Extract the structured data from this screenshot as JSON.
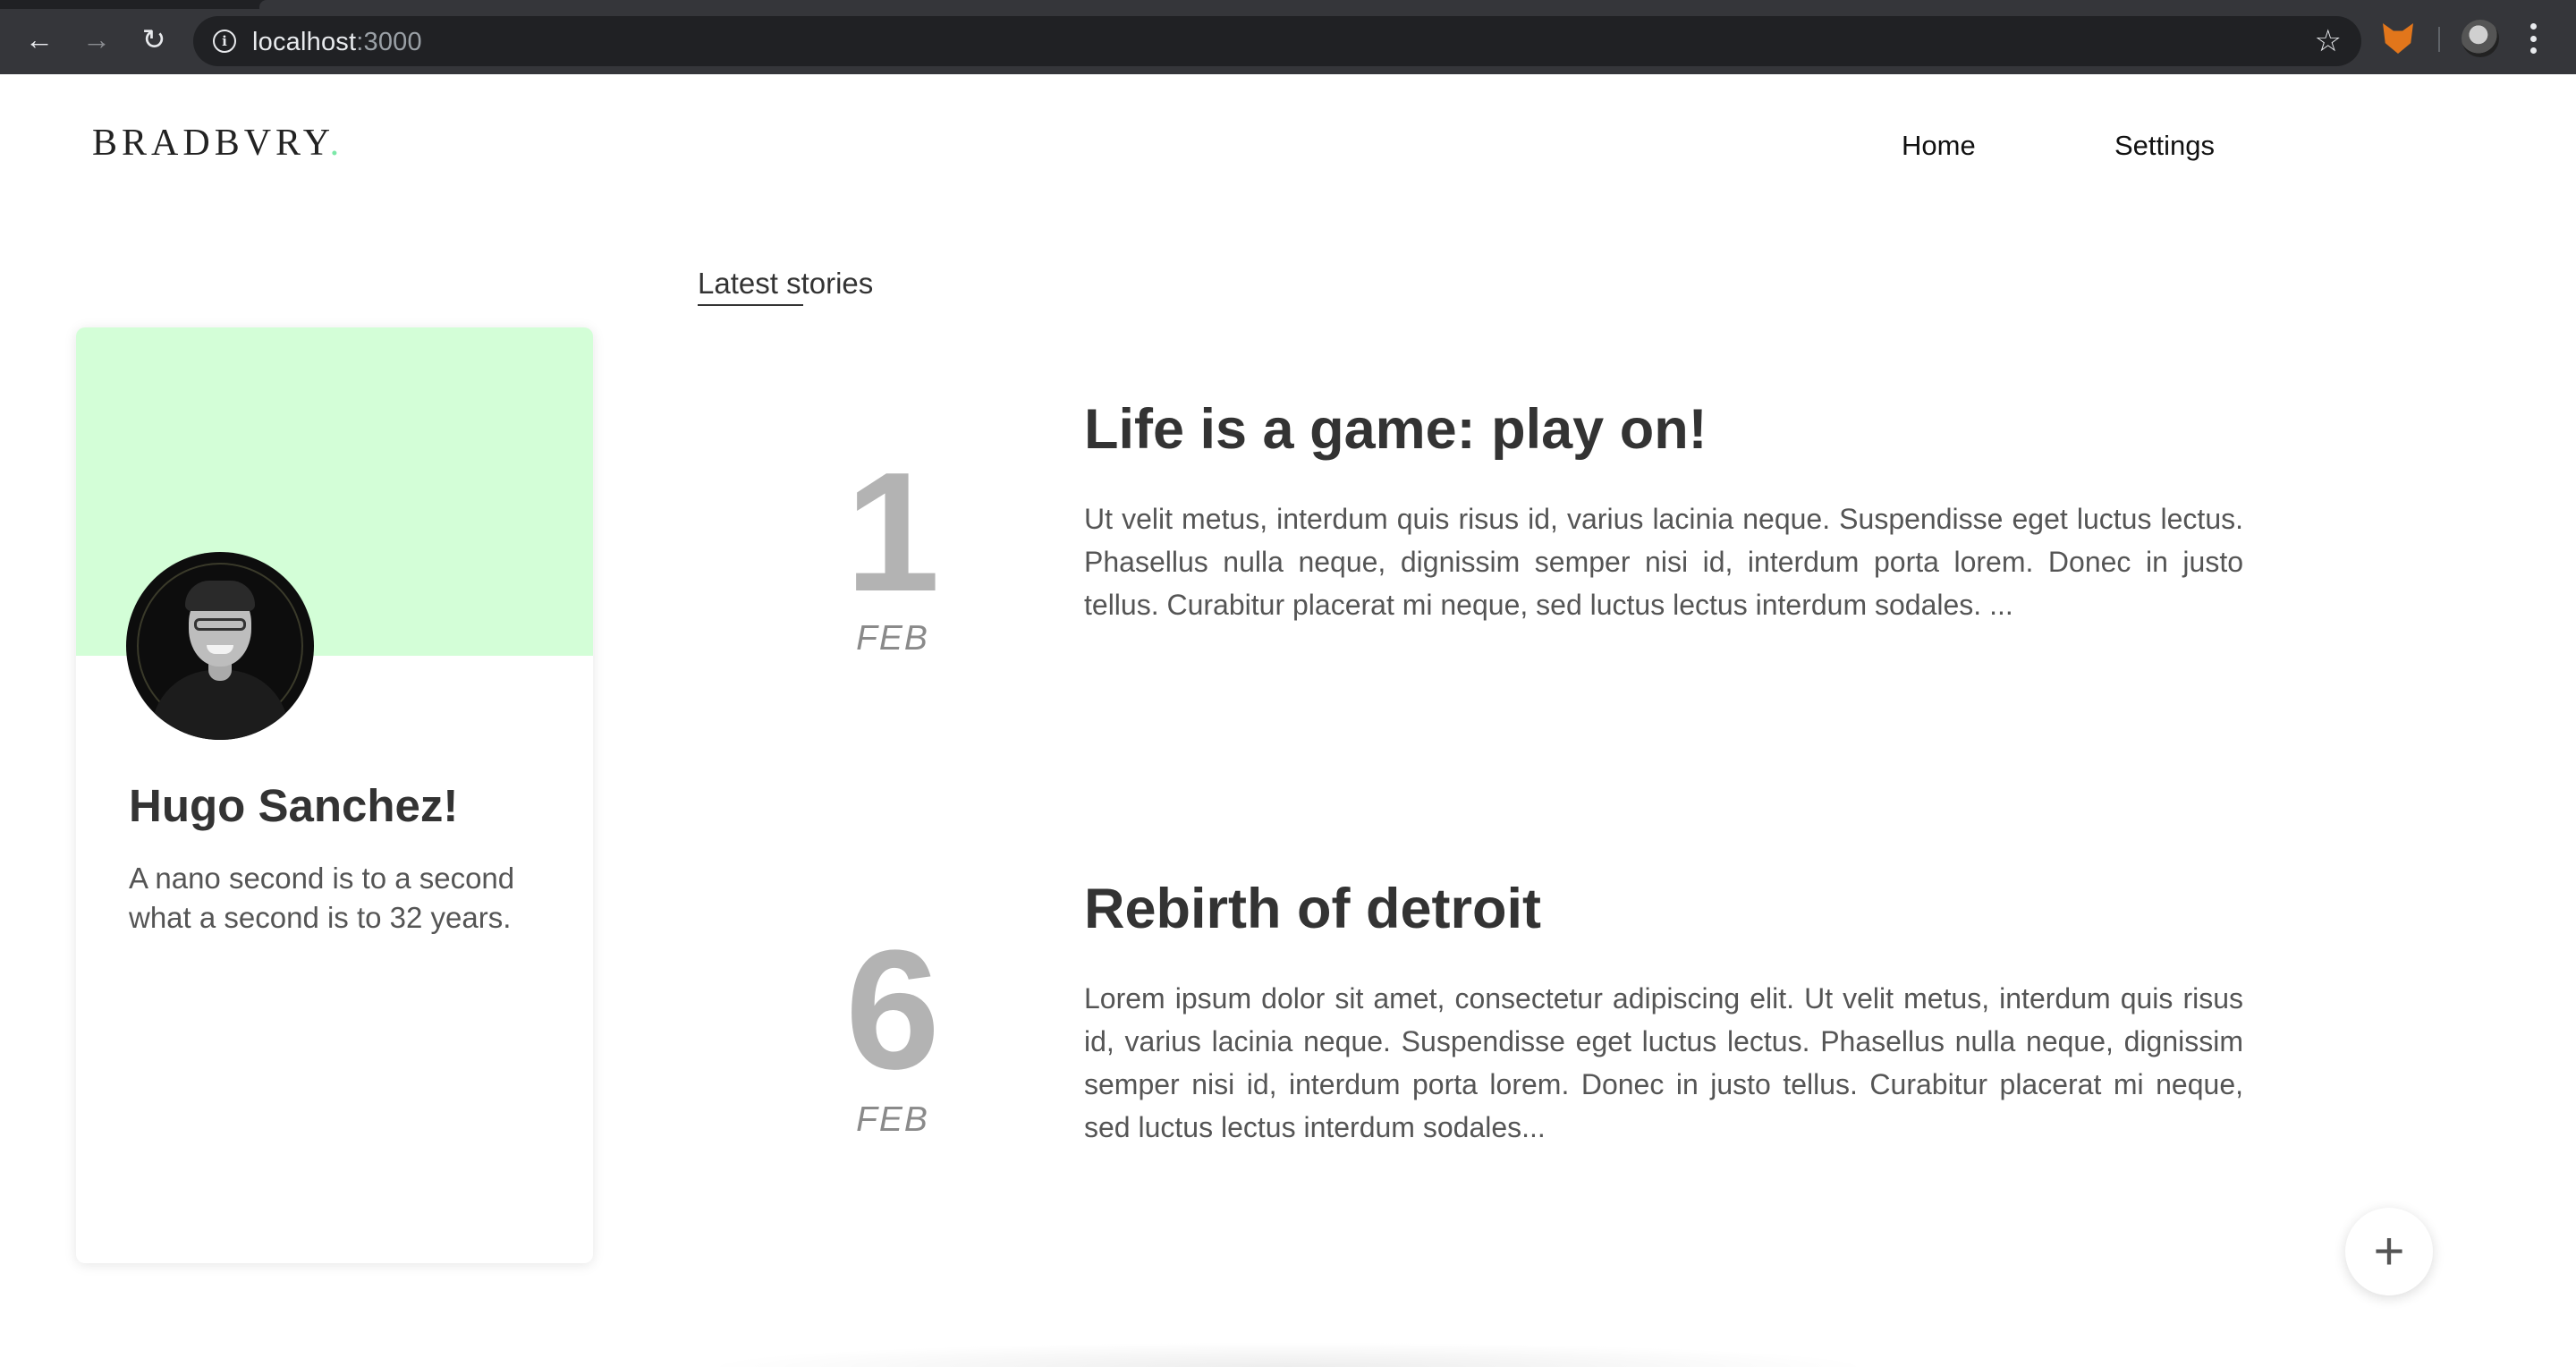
{
  "browser": {
    "url_host": "localhost",
    "url_port": ":3000",
    "icons": {
      "back": "arrow-left-icon",
      "forward": "arrow-right-icon",
      "reload": "reload-icon",
      "info": "info-icon",
      "bookmark": "star-icon",
      "extension": "fox-extension-icon",
      "profile": "profile-avatar-icon",
      "menu": "kebab-menu-icon"
    },
    "glyphs": {
      "back": "←",
      "forward": "→",
      "reload": "↻",
      "info": "i",
      "star": "☆"
    }
  },
  "header": {
    "logo_text": "BRADBVRY",
    "logo_dot": ".",
    "nav": {
      "home": "Home",
      "settings": "Settings"
    }
  },
  "profile": {
    "name": "Hugo Sanchez!",
    "bio": "A nano second is to a second what a second is to 32 years."
  },
  "main": {
    "section_label": "Latest stories",
    "stories": [
      {
        "day": "1",
        "month": "FEB",
        "title": "Life is a game: play on!",
        "excerpt": "Ut velit metus, interdum quis risus id, varius lacinia neque. Suspendisse eget luctus lectus. Phasellus nulla neque, dignissim semper nisi id, interdum porta lorem. Donec in justo tellus. Curabitur placerat mi neque, sed luctus lectus interdum sodales. ..."
      },
      {
        "day": "6",
        "month": "FEB",
        "title": "Rebirth of detroit",
        "excerpt": "Lorem ipsum dolor sit amet, consectetur adipiscing elit. Ut velit metus, interdum quis risus id, varius lacinia neque. Suspendisse eget luctus lectus. Phasellus nulla neque, dignissim semper nisi id, interdum porta lorem. Donec in justo tellus. Curabitur placerat mi neque, sed luctus lectus interdum sodales..."
      }
    ]
  },
  "fab": {
    "label": "+",
    "icon": "plus-icon"
  },
  "colors": {
    "accent": "#7ce8a8",
    "card_banner": "#d3fed7",
    "chrome_bg": "#35363a"
  }
}
